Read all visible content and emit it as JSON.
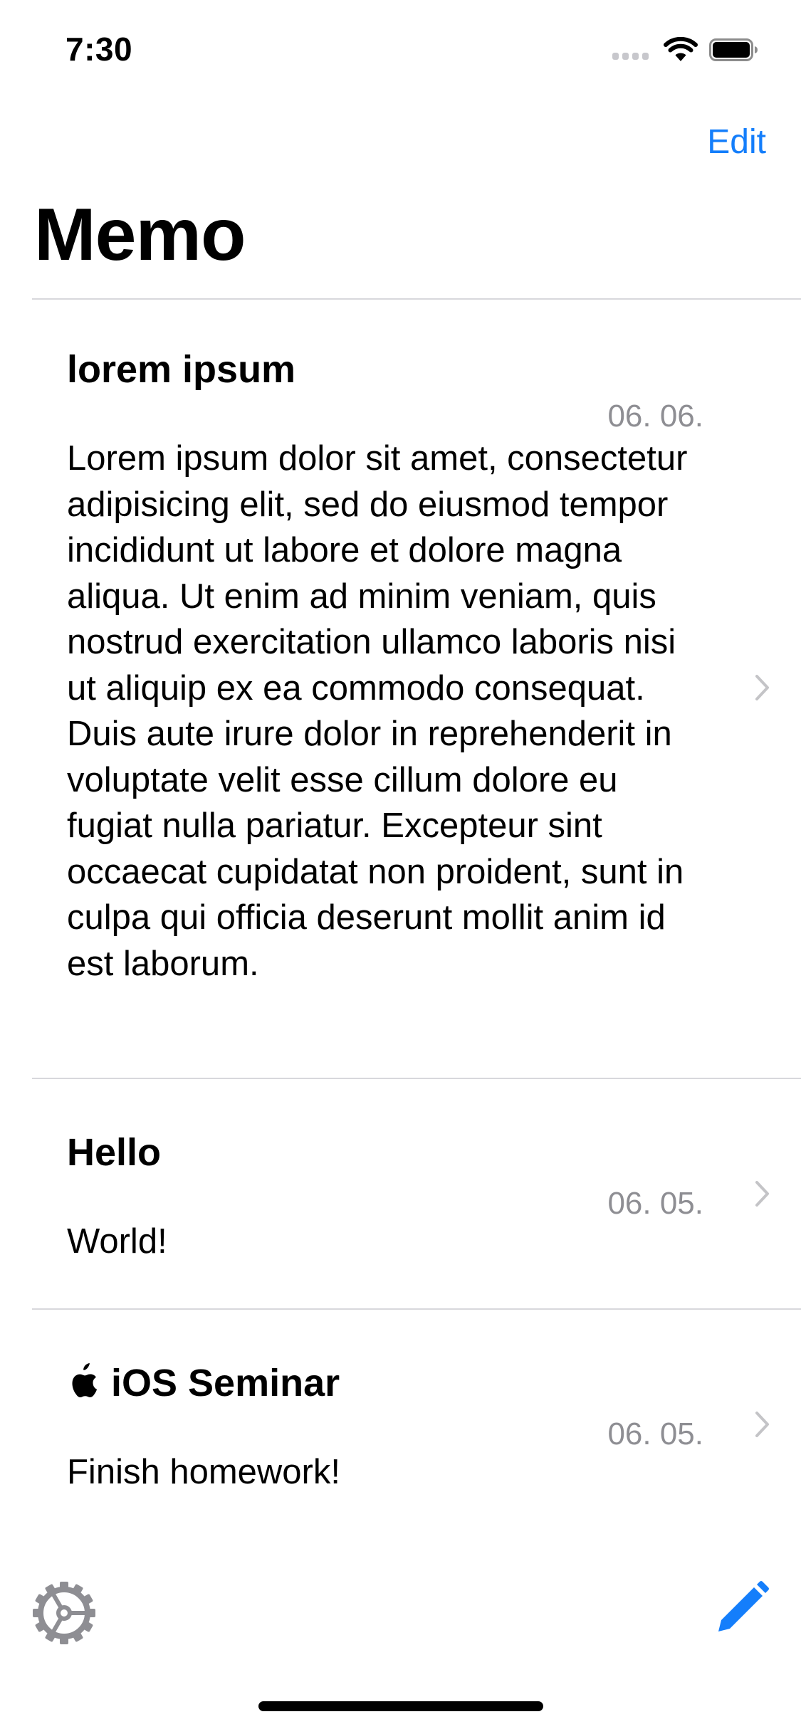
{
  "status_bar": {
    "time": "7:30"
  },
  "navigation": {
    "edit_label": "Edit",
    "title": "Memo"
  },
  "memos": [
    {
      "title": "lorem ipsum",
      "date": "06. 06.",
      "body": "Lorem ipsum dolor sit amet, consectetur adipisicing elit, sed do eiusmod tempor incididunt ut labore et dolore magna aliqua. Ut enim ad minim veniam, quis nostrud exercitation ullamco laboris nisi ut aliquip ex ea commodo consequat. Duis aute irure dolor in reprehenderit in voluptate velit esse cillum dolore eu fugiat nulla pariatur. Excepteur sint occaecat cupidatat non proident, sunt in culpa qui officia deserunt mollit anim id est laborum."
    },
    {
      "title": "Hello",
      "date": "06. 05.",
      "body": "World!"
    },
    {
      "title": "iOS Seminar",
      "title_icon": "apple-icon",
      "date": "06. 05.",
      "body": "Finish homework!"
    }
  ],
  "toolbar": {
    "left_icon": "gear-icon",
    "right_icon": "compose-icon"
  },
  "colors": {
    "accent": "#147efb",
    "secondary_text": "#8e8e93",
    "separator": "#d8d8dc",
    "chevron": "#c4c4c7",
    "gear": "#8e8e93"
  }
}
